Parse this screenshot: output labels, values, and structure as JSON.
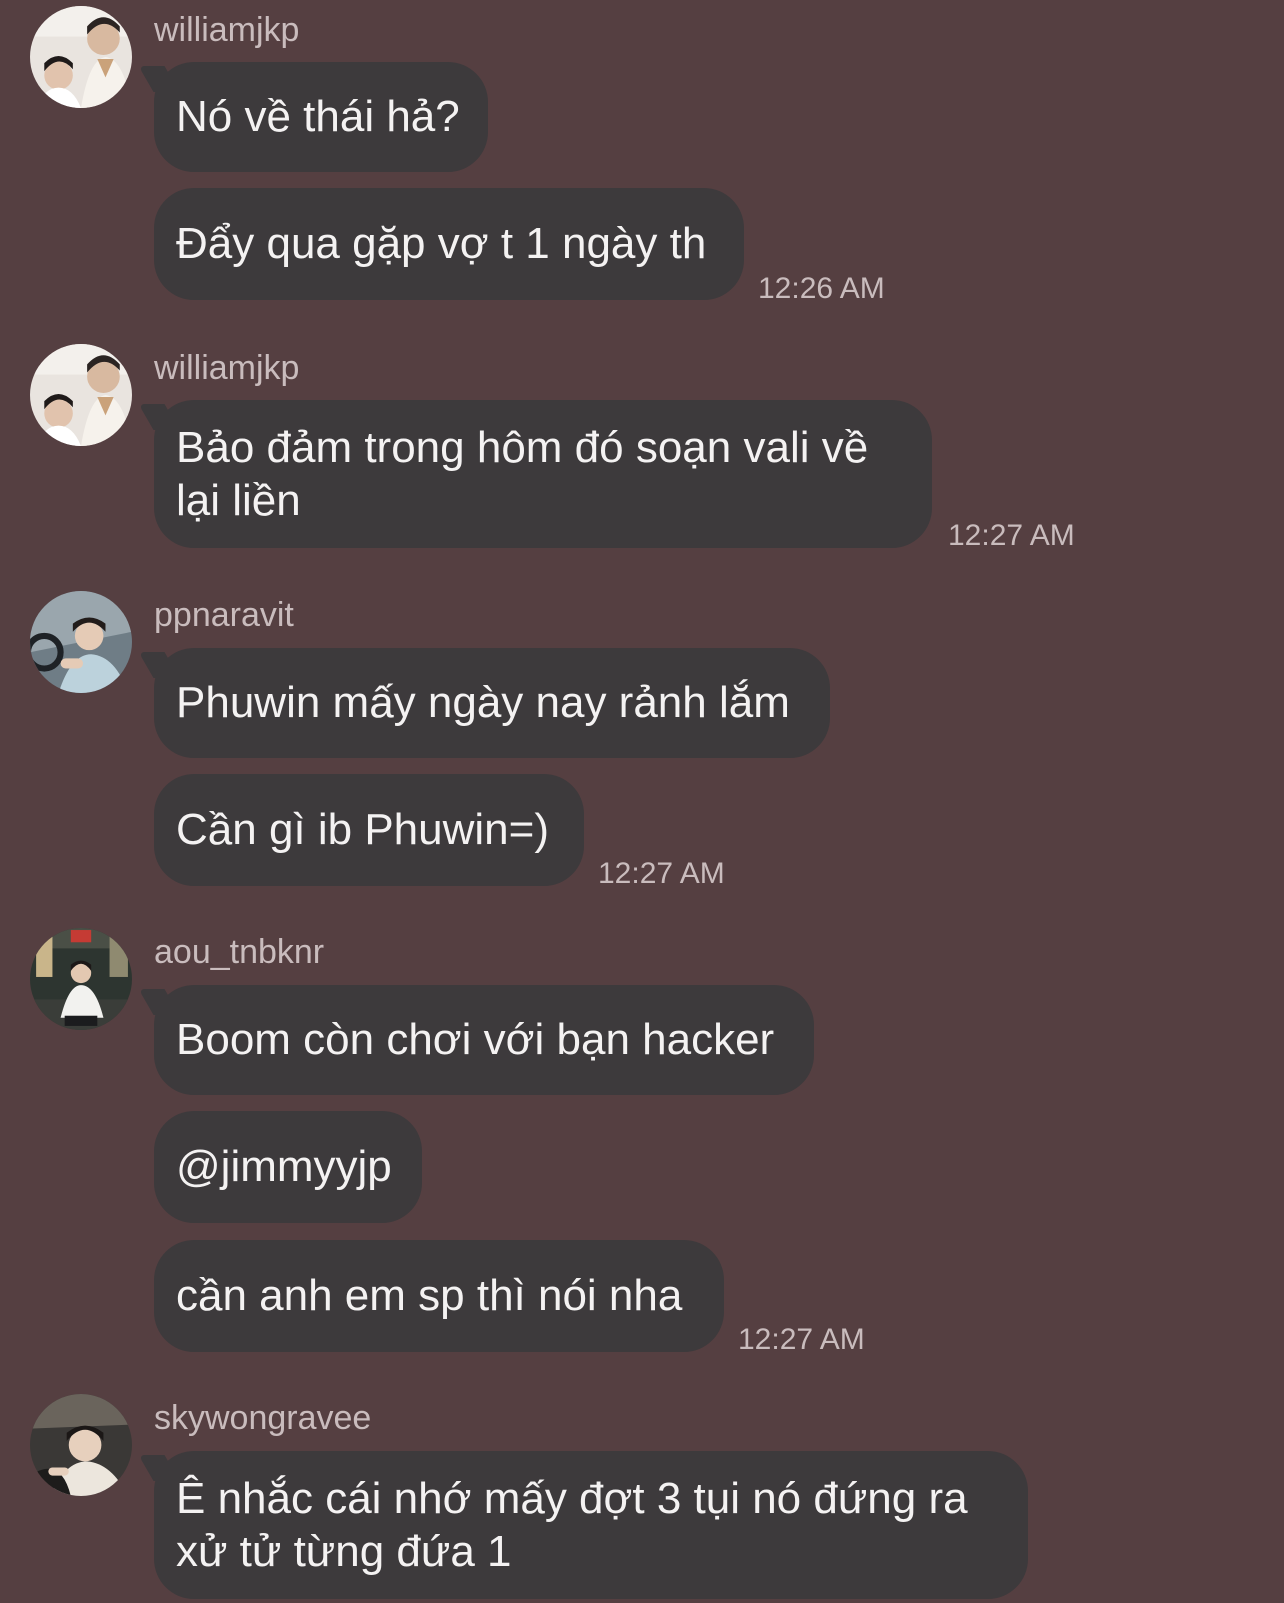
{
  "groups": [
    {
      "username": "williamjkp",
      "avatar_icon": "profile-photo-icon",
      "messages": [
        "Nó về thái hả?",
        "Đẩy qua gặp vợ t 1 ngày th"
      ],
      "time": "12:26 AM"
    },
    {
      "username": "williamjkp",
      "avatar_icon": "profile-photo-icon",
      "messages": [
        "Bảo đảm trong hôm đó soạn vali về lại liền"
      ],
      "time": "12:27 AM"
    },
    {
      "username": "ppnaravit",
      "avatar_icon": "profile-photo-icon",
      "messages": [
        "Phuwin mấy ngày nay rảnh lắm",
        "Cần gì ib Phuwin=)"
      ],
      "time": "12:27 AM"
    },
    {
      "username": "aou_tnbknr",
      "avatar_icon": "profile-photo-icon",
      "messages": [
        "Boom còn chơi với bạn hacker",
        "@jimmyyjp",
        "cần anh em sp thì nói nha"
      ],
      "time": "12:27 AM"
    },
    {
      "username": "skywongravee",
      "avatar_icon": "profile-photo-icon",
      "messages": [
        "Ê nhắc cái nhớ mấy đợt 3 tụi nó đứng ra xử tử từng đứa 1"
      ]
    }
  ],
  "colors": {
    "background": "#553f41",
    "bubble": "#3d3a3c",
    "text": "#f4f2f2",
    "meta": "#c9bcbd"
  }
}
